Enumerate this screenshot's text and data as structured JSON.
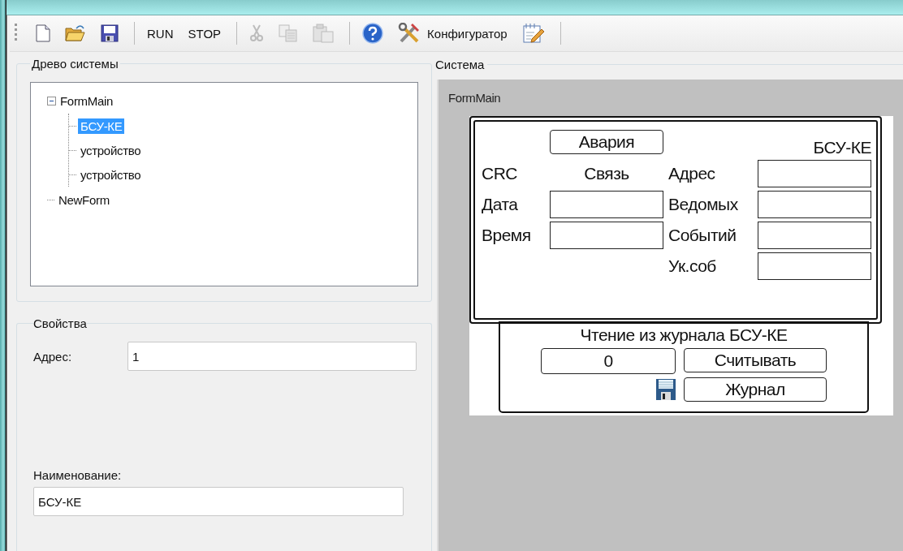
{
  "toolbar": {
    "items": [
      {
        "kind": "icon",
        "disabled": false
      },
      {
        "kind": "icon",
        "disabled": false
      },
      {
        "kind": "icon",
        "disabled": false
      },
      {
        "kind": "separator"
      },
      {
        "kind": "text",
        "label": "RUN"
      },
      {
        "kind": "text",
        "label": "STOP"
      },
      {
        "kind": "separator"
      },
      {
        "kind": "icon",
        "disabled": true
      },
      {
        "kind": "icon",
        "disabled": true
      },
      {
        "kind": "icon",
        "disabled": true
      },
      {
        "kind": "separator"
      },
      {
        "kind": "icon",
        "disabled": false
      },
      {
        "kind": "icon_text",
        "label": "Конфигуратор"
      },
      {
        "kind": "icon",
        "disabled": false
      },
      {
        "kind": "separator"
      }
    ]
  },
  "tree": {
    "title": "Древо системы",
    "items": [
      {
        "label": "FormMain",
        "selected": false,
        "expanded": true,
        "children": [
          {
            "label": "БСУ-КЕ",
            "selected": true
          },
          {
            "label": "устройство",
            "selected": false
          },
          {
            "label": "устройство",
            "selected": false
          }
        ]
      },
      {
        "label": "NewForm",
        "selected": false
      }
    ]
  },
  "properties": {
    "title": "Свойства",
    "address": {
      "label": "Адрес:",
      "value": "1"
    },
    "name": {
      "label": "Наименование:",
      "value": "БСУ-КЕ"
    }
  },
  "system": {
    "title": "Система",
    "form_title": "FormMain",
    "device": {
      "alarm_button": "Авария",
      "name": "БСУ-КЕ",
      "crc": "CRC",
      "link": "Связь",
      "left_fields": [
        {
          "label": "Дата"
        },
        {
          "label": "Время"
        }
      ],
      "right_fields": [
        {
          "label": "Адрес"
        },
        {
          "label": "Ведомых"
        },
        {
          "label": "Событий"
        },
        {
          "label": "Ук.соб"
        }
      ]
    },
    "journal": {
      "title": "Чтение из журнала БСУ-КЕ",
      "counter": "0",
      "read_button": "Считывать",
      "journal_button": "Журнал"
    }
  }
}
